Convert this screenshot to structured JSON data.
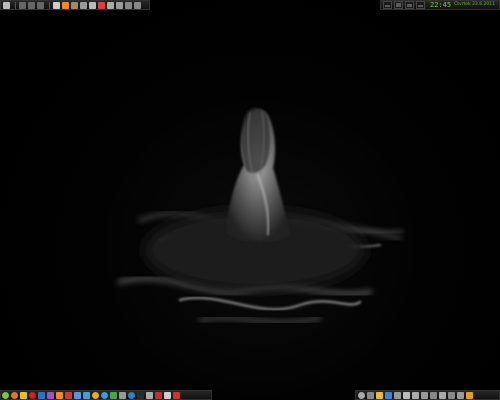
{
  "top_left_panel": {
    "icons": [
      {
        "name": "menu-icon",
        "color": "#bbbbbb"
      },
      {
        "name": "media-prev-icon",
        "color": "#666666"
      },
      {
        "name": "media-play-icon",
        "color": "#666666"
      },
      {
        "name": "media-next-icon",
        "color": "#666666"
      },
      {
        "name": "home-icon",
        "color": "#cccccc"
      },
      {
        "name": "vlc-icon",
        "color": "#f08a1c"
      },
      {
        "name": "gimp-icon",
        "color": "#9c8a6a"
      },
      {
        "name": "user-icon",
        "color": "#9a9a9a"
      },
      {
        "name": "inkscape-icon",
        "color": "#bbbbbb"
      },
      {
        "name": "flag-icon",
        "color": "#d84040"
      },
      {
        "name": "gear-icon",
        "color": "#aaaaaa"
      },
      {
        "name": "network-icon",
        "color": "#999999"
      },
      {
        "name": "shield-icon",
        "color": "#888888"
      },
      {
        "name": "power-icon",
        "color": "#888888"
      }
    ]
  },
  "top_right_panel": {
    "meters": [
      {
        "name": "cpu-meter",
        "level": 0.3
      },
      {
        "name": "memory-meter",
        "level": 0.6
      },
      {
        "name": "disk-meter",
        "level": 0.5
      },
      {
        "name": "network-meter",
        "level": 0.4
      }
    ],
    "clock": "22:45",
    "date": "Čtvrtek 23.6.2011"
  },
  "bottom_left_panel": {
    "icons": [
      {
        "name": "start-icon",
        "color": "#7fc243",
        "round": true
      },
      {
        "name": "firefox-icon",
        "color": "#e07a20",
        "round": true
      },
      {
        "name": "banana-icon",
        "color": "#e0c030"
      },
      {
        "name": "opera-icon",
        "color": "#d02020",
        "round": true
      },
      {
        "name": "picture-icon",
        "color": "#3070c0"
      },
      {
        "name": "emerald-icon",
        "color": "#a050c0"
      },
      {
        "name": "vlc-icon",
        "color": "#f08a1c"
      },
      {
        "name": "wine-icon",
        "color": "#c04040"
      },
      {
        "name": "chat-icon",
        "color": "#6090e0"
      },
      {
        "name": "network-icon",
        "color": "#40a0d0"
      },
      {
        "name": "chrome-icon",
        "color": "#e0b020",
        "round": true
      },
      {
        "name": "skype-icon",
        "color": "#30a0e0",
        "round": true
      },
      {
        "name": "download-icon",
        "color": "#50a050"
      },
      {
        "name": "tools-icon",
        "color": "#999999"
      },
      {
        "name": "globe-icon",
        "color": "#3080c0",
        "round": true
      },
      {
        "name": "terminal-icon",
        "color": "#2a2a2a"
      },
      {
        "name": "monitor-icon",
        "color": "#aaaaaa"
      },
      {
        "name": "calculator-icon",
        "color": "#c03030"
      },
      {
        "name": "calendar-icon",
        "color": "#cccccc"
      },
      {
        "name": "close-icon",
        "color": "#d03030"
      }
    ]
  },
  "bottom_right_panel": {
    "icons": [
      {
        "name": "sound-icon",
        "color": "#aaaaaa",
        "round": true
      },
      {
        "name": "update-icon",
        "color": "#888888"
      },
      {
        "name": "banana-icon",
        "color": "#e0c030"
      },
      {
        "name": "bluetooth-icon",
        "color": "#4080d0"
      },
      {
        "name": "battery-icon",
        "color": "#999999"
      },
      {
        "name": "wifi-icon",
        "color": "#bbbbbb"
      },
      {
        "name": "volume-icon",
        "color": "#aaaaaa"
      },
      {
        "name": "clipboard-icon",
        "color": "#999999"
      },
      {
        "name": "keyboard-icon",
        "color": "#888888"
      },
      {
        "name": "user-icon",
        "color": "#aaaaaa"
      },
      {
        "name": "lock-icon",
        "color": "#888888"
      },
      {
        "name": "display-icon",
        "color": "#999999"
      },
      {
        "name": "warning-icon",
        "color": "#e0a020"
      }
    ]
  }
}
